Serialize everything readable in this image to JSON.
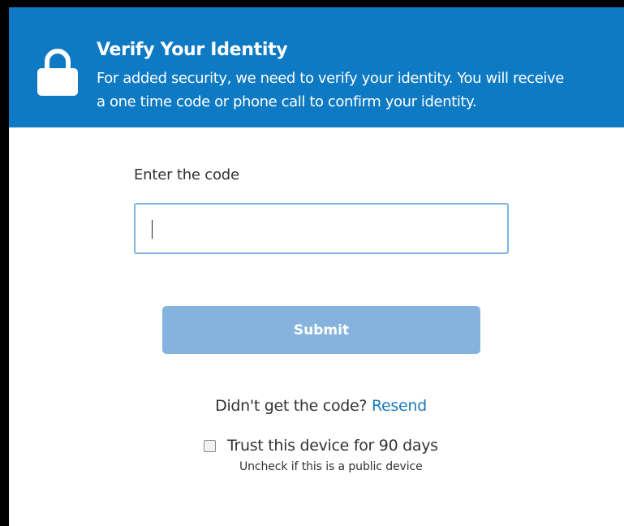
{
  "header": {
    "icon": "lock-icon",
    "title": "Verify Your Identity",
    "description_line1": "For added security, we need to verify your identity. You will receive",
    "description_line2": "a one time code or phone call to confirm your identity.",
    "background_color": "#0e7ac4"
  },
  "form": {
    "code_label": "Enter the code",
    "code_value": "",
    "submit_label": "Submit",
    "submit_color": "#86b3dd"
  },
  "resend": {
    "prompt": "Didn't get the code?",
    "link_label": "Resend",
    "link_color": "#1a7ab8"
  },
  "trust": {
    "checkbox_label": "Trust this device for 90 days",
    "checked": false,
    "hint": "Uncheck if this is a public device"
  }
}
